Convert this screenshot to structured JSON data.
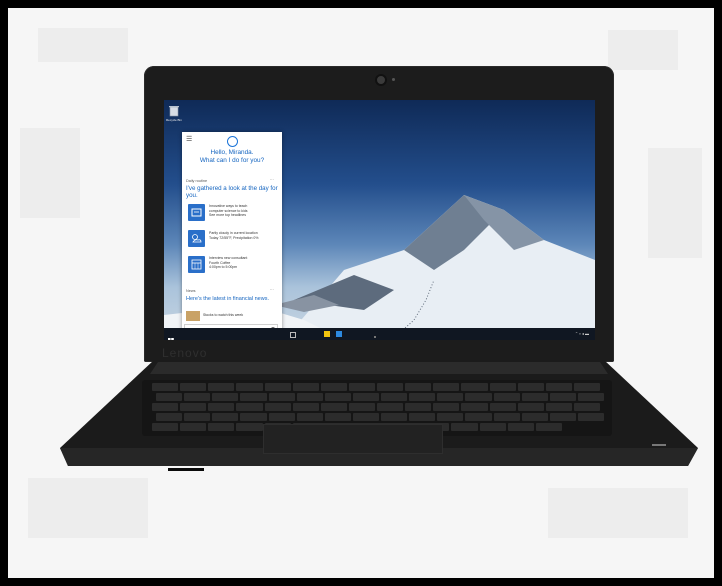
{
  "desktop": {
    "recycle_bin_label": "Recycle Bin"
  },
  "cortana": {
    "greeting_line1": "Hello, Miranda.",
    "greeting_line2": "What can I do for you?",
    "daily_routine_label": "Daily routine",
    "gathered_text": "I've gathered a look at the day for you.",
    "cards": [
      {
        "icon": "news-icon",
        "lines": [
          "Innovative ways to teach",
          "computer science to kids",
          "See more top headlines"
        ]
      },
      {
        "icon": "weather-icon",
        "lines": [
          "Partly cloudy in current location",
          "Today 72/55°F, Precipitation 0%"
        ]
      },
      {
        "icon": "calendar-icon",
        "lines": [
          "Interview new consultant",
          "Fourth Coffee",
          "4:00pm to 5:00pm"
        ]
      }
    ],
    "news_label": "News",
    "news_headline": "Here's the latest in financial news.",
    "news_item": "Stocks to watch this week",
    "search_placeholder": "Search Windows and the web"
  },
  "brand": {
    "logo_text": "Lenovo"
  }
}
